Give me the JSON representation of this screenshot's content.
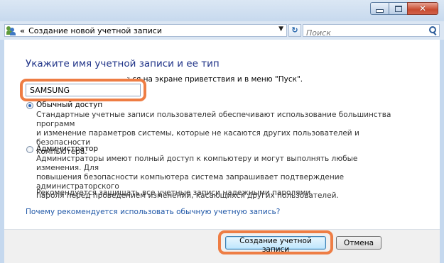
{
  "window": {
    "title": "",
    "controls": {
      "minimize": "minimize",
      "maximize": "maximize",
      "close": "✕"
    }
  },
  "address_bar": {
    "path_separator": "«",
    "path": "Создание новой учетной записи",
    "dropdown_glyph": "▼",
    "refresh_glyph": "↻",
    "search_placeholder": "Поиск",
    "search_value": ""
  },
  "content": {
    "heading": "Укажите имя учетной записи и ее тип",
    "subtext": "Это имя будет отображаться на экране приветствия и в меню \"Пуск\".",
    "account_name_value": "SAMSUNG",
    "options": [
      {
        "label": "Обычный доступ",
        "selected": true,
        "description": [
          "Стандартные учетные записи пользователей обеспечивают использование большинства программ",
          "и изменение параметров системы, которые не касаются других пользователей и безопасности",
          "компьютера."
        ]
      },
      {
        "label": "Администратор",
        "selected": false,
        "description": [
          "Администраторы имеют полный доступ к компьютеру и могут выполнять любые изменения. Для",
          "повышения безопасности компьютера система запрашивает подтверждение администраторского",
          "пароля перед проведением изменений, касающихся других пользователей."
        ],
        "recommendation": "Рекомендуется защищать все учетные записи надежными паролями."
      }
    ],
    "help_link": "Почему рекомендуется использовать обычную учетную запись?"
  },
  "footer": {
    "create_button": "Создание учетной записи",
    "cancel_button": "Отмена"
  },
  "colors": {
    "heading": "#1e3287",
    "link": "#1f57a7",
    "highlight": "#ee7d44",
    "frame": "#c5d8ee"
  },
  "icons": [
    "user-accounts-icon",
    "chevron-down-icon",
    "refresh-icon",
    "search-icon",
    "radio-icon"
  ]
}
